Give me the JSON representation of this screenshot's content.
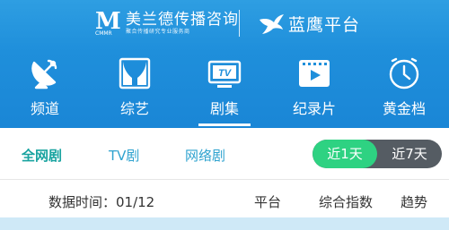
{
  "header": {
    "brand_mark": "M",
    "brand_mark_sub": "CMMR",
    "brand_name": "美兰德传播咨询",
    "brand_tagline": "聚合传播研究专业服务商",
    "partner_name": "蓝鹰平台"
  },
  "categories": [
    {
      "label": "频道",
      "icon": "satellite-dish-icon"
    },
    {
      "label": "综艺",
      "icon": "stage-curtain-icon"
    },
    {
      "label": "剧集",
      "icon": "tv-icon",
      "active": true
    },
    {
      "label": "纪录片",
      "icon": "film-play-icon"
    },
    {
      "label": "黄金档",
      "icon": "clock-icon"
    }
  ],
  "tv_icon_text": "TV",
  "filters": {
    "tabs": [
      {
        "label": "全网剧",
        "active": true
      },
      {
        "label": "TV剧"
      },
      {
        "label": "网络剧"
      }
    ],
    "period": {
      "active": "近1天",
      "inactive": "近7天"
    }
  },
  "table": {
    "data_time": "数据时间：01/12",
    "col_platform": "平台",
    "col_index": "综合指数",
    "col_trend": "趋势"
  },
  "colors": {
    "header_blue": "#1f8fdb",
    "active_tab": "#18a3a0",
    "toggle_on": "#2ed282",
    "toggle_off": "#555c63"
  }
}
